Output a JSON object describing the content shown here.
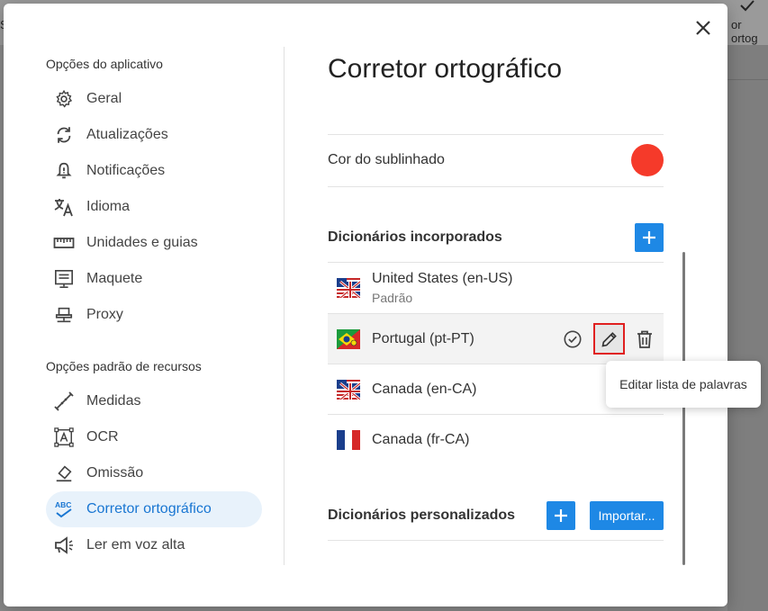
{
  "background": {
    "left_text": "S",
    "right_text": "or ortog"
  },
  "nav": {
    "app_section_title": "Opções do aplicativo",
    "app_items": [
      {
        "label": "Geral",
        "icon": "gear-icon"
      },
      {
        "label": "Atualizações",
        "icon": "refresh-icon"
      },
      {
        "label": "Notificações",
        "icon": "bell-icon"
      },
      {
        "label": "Idioma",
        "icon": "translate-icon"
      },
      {
        "label": "Unidades e guias",
        "icon": "ruler-icon"
      },
      {
        "label": "Maquete",
        "icon": "layout-icon"
      },
      {
        "label": "Proxy",
        "icon": "proxy-icon"
      }
    ],
    "resource_section_title": "Opções padrão de recursos",
    "resource_items": [
      {
        "label": "Medidas",
        "icon": "measure-icon"
      },
      {
        "label": "OCR",
        "icon": "ocr-icon"
      },
      {
        "label": "Omissão",
        "icon": "eraser-icon"
      },
      {
        "label": "Corretor ortográfico",
        "icon": "spellcheck-icon",
        "active": true
      },
      {
        "label": "Ler em voz alta",
        "icon": "megaphone-icon"
      }
    ]
  },
  "content": {
    "title": "Corretor ortográfico",
    "underline_color_label": "Cor do sublinhado",
    "underline_color": "#f53a2a",
    "builtin_title": "Dicionários incorporados",
    "dictionaries": [
      {
        "name": "United States (en-US)",
        "sub": "Padrão",
        "flag": "us-uk"
      },
      {
        "name": "Portugal (pt-PT)",
        "sub": "",
        "flag": "brazil-portugal",
        "selected": true
      },
      {
        "name": "Canada (en-CA)",
        "sub": "",
        "flag": "us-uk"
      },
      {
        "name": "Canada (fr-CA)",
        "sub": "",
        "flag": "france"
      }
    ],
    "custom_title": "Dicionários personalizados",
    "import_label": "Importar...",
    "tooltip": "Editar lista de palavras"
  },
  "colors": {
    "accent": "#1e88e5",
    "active_bg": "#e8f2fb",
    "active_text": "#1976d2",
    "highlight": "#e02020"
  }
}
